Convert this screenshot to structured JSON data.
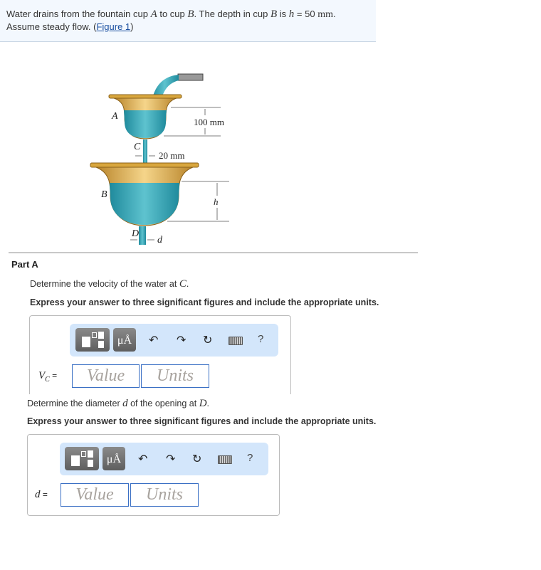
{
  "intro": {
    "t1": "Water drains from the fountain cup ",
    "A": "A",
    "t2": " to cup ",
    "B": "B",
    "t3": ". The depth in cup ",
    "B2": "B",
    "t4": " is ",
    "h": "h",
    "t5": " = 50 ",
    "unit": "mm",
    "t6": ".",
    "line2": "Assume steady flow. (",
    "link": "Figure 1",
    "close": ")"
  },
  "figure": {
    "label_A": "A",
    "label_B": "B",
    "label_C": "C",
    "label_D": "D",
    "dim_100": "100 mm",
    "dim_20": "20 mm",
    "dim_h": "h",
    "dim_d": "d"
  },
  "partA": {
    "title": "Part A",
    "q1_text": "Determine the velocity of the water at ",
    "q1_var": "C",
    "q1_end": ".",
    "instr": "Express your answer to three significant figures and include the appropriate units.",
    "label_v": "V",
    "label_sub": "C",
    "eq": " =",
    "value_placeholder": "Value",
    "units_placeholder": "Units"
  },
  "partB": {
    "q_text": "Determine the diameter ",
    "q_var": "d",
    "q_mid": " of the opening at ",
    "q_var2": "D",
    "q_end": ".",
    "instr": "Express your answer to three significant figures and include the appropriate units.",
    "label": "d",
    "eq": " =",
    "value_placeholder": "Value",
    "units_placeholder": "Units"
  },
  "toolbar": {
    "templates_icon": "fraction-template-icon",
    "units_label": "μÅ",
    "undo_icon": "↶",
    "redo_icon": "↷",
    "reset_icon": "↻",
    "keyboard_icon": "keyboard-icon",
    "help_label": "?"
  },
  "colors": {
    "toolbar_bg": "#d3e6fb",
    "field_border": "#3a6fc4",
    "water": "#2aa4b8",
    "cup": "#d9a73e"
  }
}
